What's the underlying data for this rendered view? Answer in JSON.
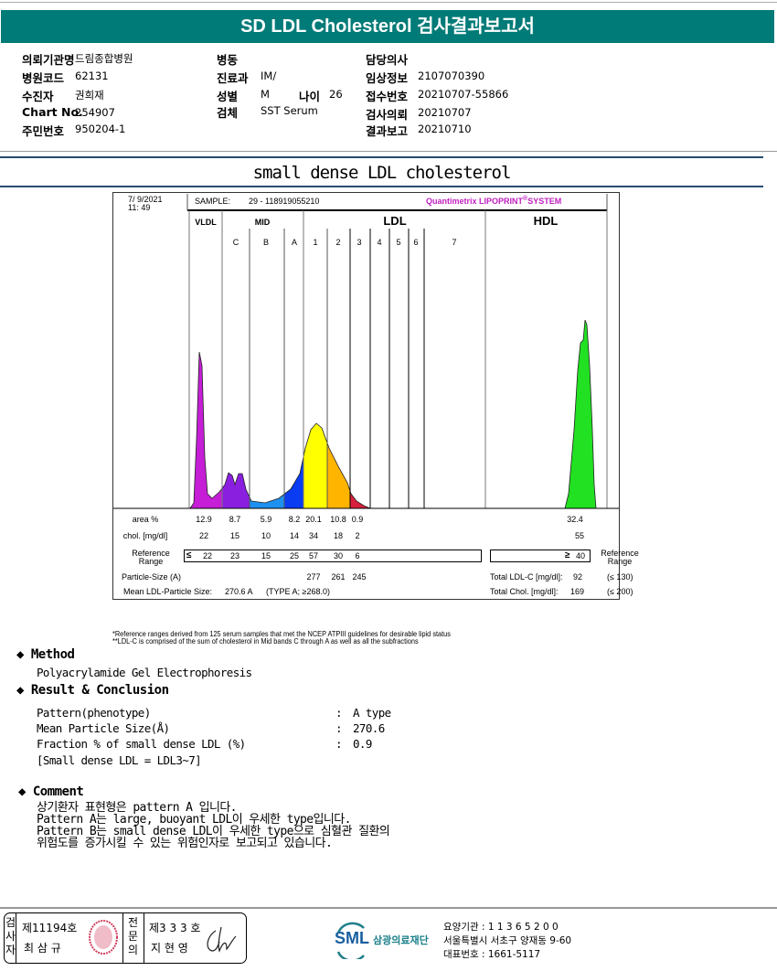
{
  "title": "SD LDL Cholesterol 검사결과보고서",
  "patient": {
    "col1": [
      {
        "label": "의뢰기관명",
        "value": "드림종합병원"
      },
      {
        "label": "병원코드",
        "value": "62131"
      },
      {
        "label": "수진자",
        "value": "권희재"
      },
      {
        "label": "Chart No.",
        "value": "254907"
      },
      {
        "label": "주민번호",
        "value": "950204-1"
      }
    ],
    "col2": [
      {
        "label": "병동",
        "value": ""
      },
      {
        "label": "진료과",
        "value": "IM/"
      },
      {
        "label": "성별",
        "value": "M"
      },
      {
        "label": "검체",
        "value": "SST Serum"
      }
    ],
    "age_label": "나이",
    "age_value": "26",
    "col3": [
      {
        "label": "담당의사",
        "value": ""
      },
      {
        "label": "임상정보",
        "value": "2107070390"
      },
      {
        "label": "접수번호",
        "value": "20210707-55866"
      },
      {
        "label": "검사의뢰",
        "value": "20210707"
      },
      {
        "label": "결과보고",
        "value": "20210710"
      }
    ]
  },
  "section_title": "small dense LDL cholesterol",
  "lipoprint": {
    "date": "7/  9/2021",
    "time": "11:  49",
    "sample_label": "SAMPLE:",
    "sample_id": "29 - 118919055210",
    "brand": "Quantimetrix LIPOPRINT",
    "brand_mark": "®",
    "brand_tail": "SYSTEM",
    "groups": [
      "VLDL",
      "MID",
      "LDL",
      "HDL"
    ],
    "subbands": [
      "C",
      "B",
      "A",
      "1",
      "2",
      "3",
      "4",
      "5",
      "6",
      "7"
    ],
    "colors": {
      "VLDL": "#c51ed6",
      "C": "#8a1fe0",
      "B": "#1e90f0",
      "A": "#0a3cf2",
      "1": "#ffff00",
      "2": "#ffb400",
      "3": "#d8203c",
      "HDL": "#22e022"
    },
    "rows": {
      "area_label": "area %",
      "area": [
        "12.9",
        "8.7",
        "5.9",
        "8.2",
        "20.1",
        "10.8",
        "0.9"
      ],
      "area_hdl": "32.4",
      "chol_label": "chol. [mg/dl]",
      "chol": [
        "22",
        "15",
        "10",
        "14",
        "34",
        "18",
        "2"
      ],
      "chol_hdl": "55",
      "ref_label_1": "Reference",
      "ref_label_2": "Range",
      "ref_first_symbol": "≤",
      "ref": [
        "22",
        "23",
        "15",
        "25",
        "57",
        "30",
        "6"
      ],
      "ref_hdl_symbol": "≥",
      "ref_hdl": "40",
      "particle_label": "Particle-Size (A)",
      "particle": [
        "277",
        "261",
        "245"
      ],
      "mean_label": "Mean LDL-Particle Size:",
      "mean_value": "270.6  A",
      "mean_type": "(TYPE A; ≥268.0)",
      "total_ldl_label": "Total LDL-C [mg/dl]:",
      "total_ldl": "92",
      "total_ldl_ref": "(≤ 130)",
      "total_chol_label": "Total Chol. [mg/dl]:",
      "total_chol": "169",
      "total_chol_ref": "(≤ 200)"
    },
    "footnote1": "*Reference ranges derived from 125 serum samples that met the NCEP ATPIII guidelines for desirable lipid status",
    "footnote2": "**LDL-C is comprised of the sum of cholesterol in Mid bands C through A as well as all the subfractions"
  },
  "chart_data": {
    "type": "area",
    "categories": [
      "VLDL",
      "C",
      "B",
      "A",
      "1",
      "2",
      "3",
      "4",
      "5",
      "6",
      "7",
      "HDL"
    ],
    "area_percent": [
      12.9,
      8.7,
      5.9,
      8.2,
      20.1,
      10.8,
      0.9,
      null,
      null,
      null,
      null,
      32.4
    ],
    "cholesterol_mg_dl": [
      22,
      15,
      10,
      14,
      34,
      18,
      2,
      null,
      null,
      null,
      null,
      55
    ]
  },
  "method": {
    "heading": "Method",
    "text": "Polyacrylamide Gel Electrophoresis"
  },
  "result": {
    "heading": "Result & Conclusion",
    "items": [
      {
        "label": "Pattern(phenotype)",
        "value": "A type"
      },
      {
        "label": "Mean Particle Size(Å)",
        "value": "270.6"
      },
      {
        "label": "Fraction % of small dense LDL (%)",
        "value": "0.9"
      }
    ],
    "note": "[Small dense LDL = LDL3~7]",
    "colon": ":"
  },
  "comment": {
    "heading": "Comment",
    "lines": [
      "상기환자 표현형은 pattern A 입니다.",
      "Pattern A는 large, buoyant LDL이 우세한 type입니다.",
      "Pattern B는 small dense LDL이 우세한 type으로 심혈관 질환의",
      "위험도를 증가시킬 수 있는 위험인자로 보고되고 있습니다."
    ]
  },
  "footer": {
    "examiner_label": "검사자",
    "examiner_no": "제11194호",
    "examiner_name": "최 삼 규",
    "reviewer_label": "전문의",
    "reviewer_no": "제3 3 3 호",
    "reviewer_name": "지 현 영",
    "logo_text": "SML",
    "org_name": "삼광의료재단",
    "care_code": "요양기관 : 1 1 3 6 5 2 0 0",
    "address": "서울특별시 서초구 양재동 9-60",
    "phone": "대표번호 : 1661-5117"
  }
}
